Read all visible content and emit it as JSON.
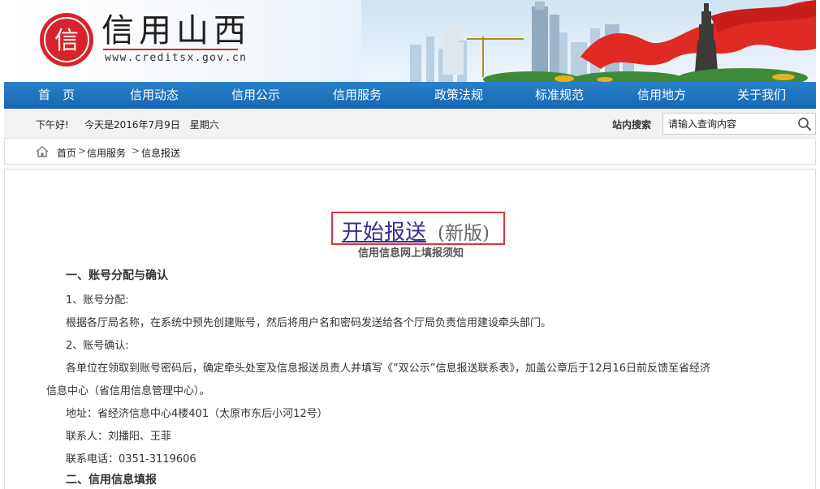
{
  "header": {
    "logo_glyph": "信",
    "site_title": "信用山西",
    "site_url": "www.creditsx.gov.cn",
    "brand_color": "#d8232a"
  },
  "nav": {
    "items": [
      {
        "label": "首　页"
      },
      {
        "label": "信用动态"
      },
      {
        "label": "信用公示"
      },
      {
        "label": "信用服务"
      },
      {
        "label": "政策法规"
      },
      {
        "label": "标准规范"
      },
      {
        "label": "信用地方"
      },
      {
        "label": "关于我们"
      }
    ],
    "bg_color": "#1a6cb6"
  },
  "infobar": {
    "greeting": "下午好!",
    "date_text": "今天是2016年7月9日　星期六",
    "search_label": "站内搜索",
    "search_value": "请输入查询内容",
    "search_icon": "search-icon"
  },
  "breadcrumb": {
    "home_icon": "home-icon",
    "items": [
      "首页",
      "信用服务",
      "信息报送"
    ],
    "separator": ">"
  },
  "article": {
    "headline_link": "开始报送",
    "headline_suffix": "(新版)",
    "subtitle": "信用信息网上填报须知",
    "section1_title": "一、账号分配与确认",
    "item1_title": "1、账号分配:",
    "item1_body": "根据各厅局名称，在系统中预先创建账号，然后将用户名和密码发送给各个厅局负责信用建设牵头部门。",
    "item2_title": "2、账号确认:",
    "item2_body_line1": "各单位在领取到账号密码后，确定牵头处室及信息报送员责人并填写《”双公示”信息报送联系表》，加盖公章后于12月16日前反馈至省经济",
    "item2_body_line2": "信息中心（省信用信息管理中心）。",
    "address": "地址：省经济信息中心4楼401（太原市东后小河12号）",
    "contacts": "联系人：刘播阳、王菲",
    "phone": "联系电话：0351-3119606",
    "section2_title": "二、信用信息填报"
  }
}
